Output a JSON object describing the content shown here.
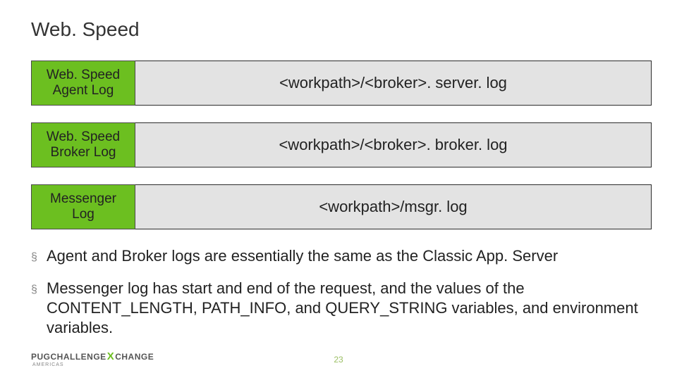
{
  "title": "Web. Speed",
  "rows": [
    {
      "label": "Web. Speed\nAgent Log",
      "value": "<workpath>/<broker>. server. log"
    },
    {
      "label": "Web. Speed\nBroker Log",
      "value": "<workpath>/<broker>. broker. log"
    },
    {
      "label": "Messenger\nLog",
      "value": "<workpath>/msgr. log"
    }
  ],
  "bullets": [
    "Agent and Broker logs are essentially the same as the Classic App. Server",
    "Messenger log has start and end of the request, and the values of the CONTENT_LENGTH, PATH_INFO, and QUERY_STRING variables, and environment variables."
  ],
  "footer": {
    "brand_left": "PUG",
    "brand_mid": "CHALLENGE",
    "brand_x": "X",
    "brand_right": "CHANGE",
    "brand_sub": "AMERICAS"
  },
  "page_number": "23"
}
